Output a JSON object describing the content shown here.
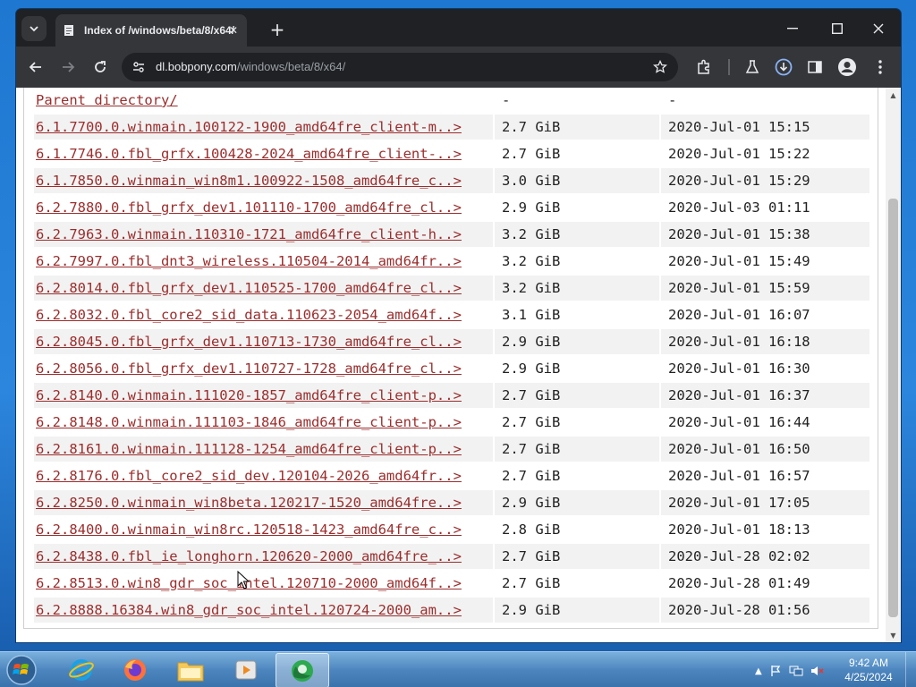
{
  "browser": {
    "tab_title": "Index of /windows/beta/8/x64/",
    "url_host": "dl.bobpony.com",
    "url_path": "/windows/beta/8/x64/"
  },
  "listing": {
    "parent": {
      "name": "Parent directory/",
      "size": "-",
      "date": "-"
    },
    "rows": [
      {
        "name": "6.1.7700.0.winmain.100122-1900_amd64fre_client-m..>",
        "size": "2.7 GiB",
        "date": "2020-Jul-01 15:15"
      },
      {
        "name": "6.1.7746.0.fbl_grfx.100428-2024_amd64fre_client-..>",
        "size": "2.7 GiB",
        "date": "2020-Jul-01 15:22"
      },
      {
        "name": "6.1.7850.0.winmain_win8m1.100922-1508_amd64fre_c..>",
        "size": "3.0 GiB",
        "date": "2020-Jul-01 15:29"
      },
      {
        "name": "6.2.7880.0.fbl_grfx_dev1.101110-1700_amd64fre_cl..>",
        "size": "2.9 GiB",
        "date": "2020-Jul-03 01:11"
      },
      {
        "name": "6.2.7963.0.winmain.110310-1721_amd64fre_client-h..>",
        "size": "3.2 GiB",
        "date": "2020-Jul-01 15:38"
      },
      {
        "name": "6.2.7997.0.fbl_dnt3_wireless.110504-2014_amd64fr..>",
        "size": "3.2 GiB",
        "date": "2020-Jul-01 15:49"
      },
      {
        "name": "6.2.8014.0.fbl_grfx_dev1.110525-1700_amd64fre_cl..>",
        "size": "3.2 GiB",
        "date": "2020-Jul-01 15:59"
      },
      {
        "name": "6.2.8032.0.fbl_core2_sid_data.110623-2054_amd64f..>",
        "size": "3.1 GiB",
        "date": "2020-Jul-01 16:07"
      },
      {
        "name": "6.2.8045.0.fbl_grfx_dev1.110713-1730_amd64fre_cl..>",
        "size": "2.9 GiB",
        "date": "2020-Jul-01 16:18"
      },
      {
        "name": "6.2.8056.0.fbl_grfx_dev1.110727-1728_amd64fre_cl..>",
        "size": "2.9 GiB",
        "date": "2020-Jul-01 16:30"
      },
      {
        "name": "6.2.8140.0.winmain.111020-1857_amd64fre_client-p..>",
        "size": "2.7 GiB",
        "date": "2020-Jul-01 16:37"
      },
      {
        "name": "6.2.8148.0.winmain.111103-1846_amd64fre_client-p..>",
        "size": "2.7 GiB",
        "date": "2020-Jul-01 16:44"
      },
      {
        "name": "6.2.8161.0.winmain.111128-1254_amd64fre_client-p..>",
        "size": "2.7 GiB",
        "date": "2020-Jul-01 16:50"
      },
      {
        "name": "6.2.8176.0.fbl_core2_sid_dev.120104-2026_amd64fr..>",
        "size": "2.7 GiB",
        "date": "2020-Jul-01 16:57"
      },
      {
        "name": "6.2.8250.0.winmain_win8beta.120217-1520_amd64fre..>",
        "size": "2.9 GiB",
        "date": "2020-Jul-01 17:05"
      },
      {
        "name": "6.2.8400.0.winmain_win8rc.120518-1423_amd64fre_c..>",
        "size": "2.8 GiB",
        "date": "2020-Jul-01 18:13"
      },
      {
        "name": "6.2.8438.0.fbl_ie_longhorn.120620-2000_amd64fre_..>",
        "size": "2.7 GiB",
        "date": "2020-Jul-28 02:02"
      },
      {
        "name": "6.2.8513.0.win8_gdr_soc_intel.120710-2000_amd64f..>",
        "size": "2.7 GiB",
        "date": "2020-Jul-28 01:49"
      },
      {
        "name": "6.2.8888.16384.win8_gdr_soc_intel.120724-2000_am..>",
        "size": "2.9 GiB",
        "date": "2020-Jul-28 01:56"
      }
    ]
  },
  "taskbar": {
    "apps": [
      "internet-explorer",
      "firefox",
      "file-explorer",
      "media-player",
      "chrome-canary"
    ],
    "clock_time": "9:42 AM",
    "clock_date": "4/25/2024"
  },
  "colors": {
    "link": "#9b2d2d",
    "row_alt": "#f2f2f2",
    "chrome_dark": "#202124",
    "chrome_toolbar": "#35363a"
  }
}
